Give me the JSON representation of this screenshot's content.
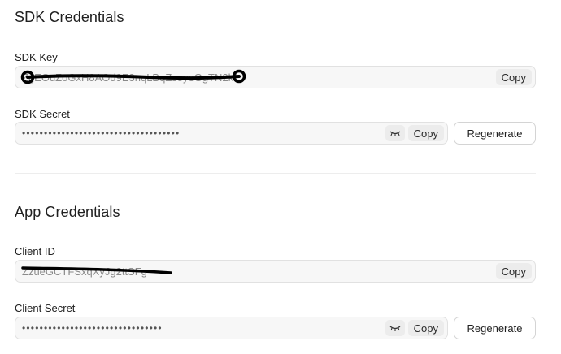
{
  "sdk": {
    "title": "SDK Credentials",
    "key": {
      "label": "SDK Key",
      "value": "ZgEOuZoGxH8AOd9E3nqLBqZsoyeGgTN2k1",
      "copy_label": "Copy"
    },
    "secret": {
      "label": "SDK Secret",
      "value": "••••••••••••••••••••••••••••••••••••",
      "copy_label": "Copy",
      "regenerate_label": "Regenerate",
      "reveal_icon": "eye-closed-icon"
    }
  },
  "app": {
    "title": "App Credentials",
    "client_id": {
      "label": "Client ID",
      "value": "ZzueGCTFSxqXyJg2ttSFg",
      "copy_label": "Copy"
    },
    "client_secret": {
      "label": "Client Secret",
      "value": "••••••••••••••••••••••••••••••••",
      "copy_label": "Copy",
      "regenerate_label": "Regenerate",
      "reveal_icon": "eye-closed-icon"
    }
  },
  "colors": {
    "field_background": "#f7f7f7",
    "field_border": "#e1e1e1",
    "button_background": "#ececec",
    "redaction_ink": "#000000"
  }
}
